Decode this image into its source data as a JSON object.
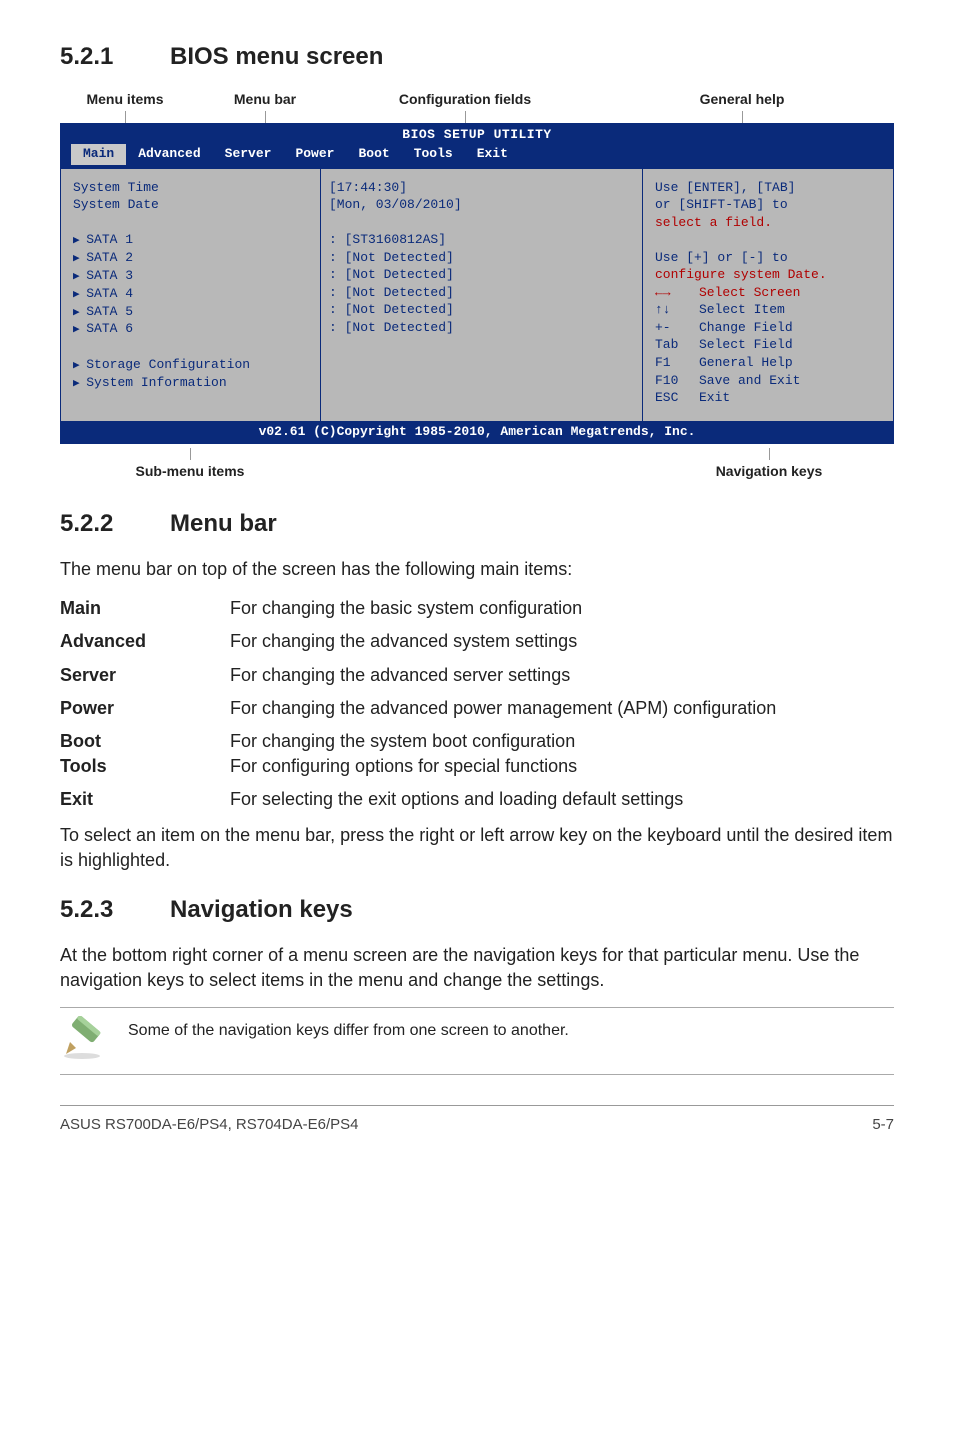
{
  "sections": {
    "s1": {
      "num": "5.2.1",
      "title": "BIOS menu screen"
    },
    "s2": {
      "num": "5.2.2",
      "title": "Menu bar"
    },
    "s3": {
      "num": "5.2.3",
      "title": "Navigation keys"
    }
  },
  "diagram_labels": {
    "menu_items": "Menu items",
    "menu_bar": "Menu bar",
    "config_fields": "Configuration fields",
    "general_help": "General help",
    "sub_menu_items": "Sub-menu items",
    "nav_keys": "Navigation keys"
  },
  "bios": {
    "title": "BIOS SETUP UTILITY",
    "menubar": [
      "Main",
      "Advanced",
      "Server",
      "Power",
      "Boot",
      "Tools",
      "Exit"
    ],
    "left": {
      "time": "System Time",
      "date": "System Date",
      "sata": [
        "SATA 1",
        "SATA 2",
        "SATA 3",
        "SATA 4",
        "SATA 5",
        "SATA 6"
      ],
      "storage": "Storage Configuration",
      "sysinfo": "System Information"
    },
    "mid": {
      "time_val": "[17:44:30]",
      "date_val": "[Mon, 03/08/2010]",
      "sata_vals": [
        "[ST3160812AS]",
        "[Not Detected]",
        "[Not Detected]",
        "[Not Detected]",
        "[Not Detected]",
        "[Not Detected]"
      ]
    },
    "help_top": [
      "Use [ENTER], [TAB]",
      "or [SHIFT-TAB] to",
      "select a field.",
      "",
      "Use [+] or [-] to",
      "configure system Date."
    ],
    "help_bottom": [
      {
        "k": "←→",
        "t": "Select Screen",
        "red": true
      },
      {
        "k": "↑↓",
        "t": "Select Item",
        "red": false
      },
      {
        "k": "+-",
        "t": "Change Field",
        "red": false
      },
      {
        "k": "Tab",
        "t": "Select Field",
        "red": false
      },
      {
        "k": "F1",
        "t": "General Help",
        "red": false
      },
      {
        "k": "F10",
        "t": "Save and Exit",
        "red": false
      },
      {
        "k": "ESC",
        "t": "Exit",
        "red": false
      }
    ],
    "footer": "v02.61 (C)Copyright 1985-2010, American Megatrends, Inc."
  },
  "menu_bar_intro": "The menu bar on top of the screen has the following main items:",
  "defs": [
    {
      "term": "Main",
      "desc": "For changing the basic system configuration"
    },
    {
      "term": "Advanced",
      "desc": "For changing the advanced system settings"
    },
    {
      "term": "Server",
      "desc": "For changing the advanced server settings"
    },
    {
      "term": "Power",
      "desc": "For changing the advanced power management (APM) configuration"
    },
    {
      "term": "Boot",
      "desc": "For changing the system boot configuration"
    },
    {
      "term": "Tools",
      "desc": "For configuring options for special functions"
    },
    {
      "term": "Exit",
      "desc": "For selecting the exit options and loading default settings"
    }
  ],
  "menu_bar_outro": "To select an item on the menu bar, press the right or left arrow key on the keyboard until the desired item is highlighted.",
  "nav_keys_text": "At the bottom right corner of a menu screen are the navigation keys for that particular menu. Use the navigation keys to select items in the menu and change the settings.",
  "note_text": "Some of the navigation keys differ from one screen to another.",
  "footer": {
    "left": "ASUS RS700DA-E6/PS4, RS704DA-E6/PS4",
    "right": "5-7"
  }
}
